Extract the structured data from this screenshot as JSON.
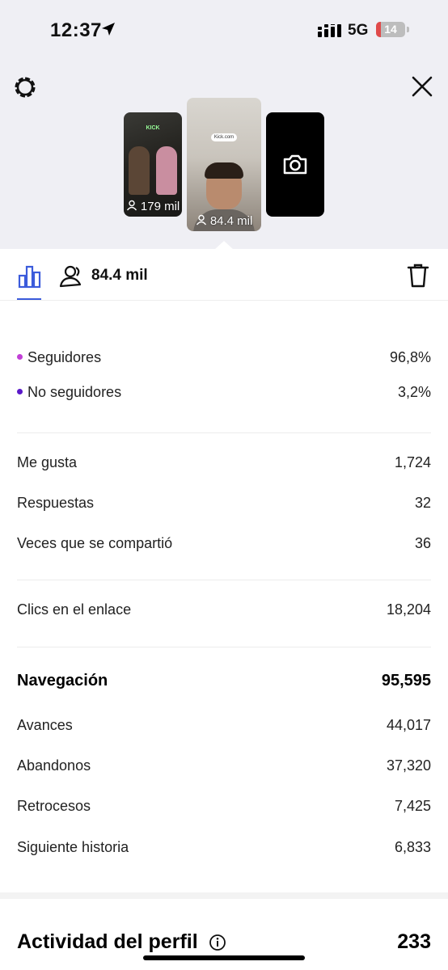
{
  "status_bar": {
    "time": "12:37",
    "network": "5G",
    "battery": "14"
  },
  "stories": [
    {
      "title": "KICK",
      "views": "179 mil"
    },
    {
      "pill": "Kick.com",
      "views": "84.4 mil"
    }
  ],
  "tabs": {
    "reach": "84.4 mil"
  },
  "audience": [
    {
      "label": "Seguidores",
      "value": "96,8%",
      "color": "#c13fd6"
    },
    {
      "label": "No seguidores",
      "value": "3,2%",
      "color": "#5a19c9"
    }
  ],
  "interactions": [
    {
      "label": "Me gusta",
      "value": "1,724"
    },
    {
      "label": "Respuestas",
      "value": "32"
    },
    {
      "label": "Veces que se compartió",
      "value": "36"
    }
  ],
  "link_clicks": {
    "label": "Clics en el enlace",
    "value": "18,204"
  },
  "navigation": {
    "title": "Navegación",
    "total": "95,595",
    "rows": [
      {
        "label": "Avances",
        "value": "44,017"
      },
      {
        "label": "Abandonos",
        "value": "37,320"
      },
      {
        "label": "Retrocesos",
        "value": "7,425"
      },
      {
        "label": "Siguiente historia",
        "value": "6,833"
      }
    ]
  },
  "profile_activity": {
    "title": "Actividad del perfil",
    "value": "233"
  },
  "colors": {
    "accent": "#3b5bdb",
    "background": "#efeff4"
  }
}
